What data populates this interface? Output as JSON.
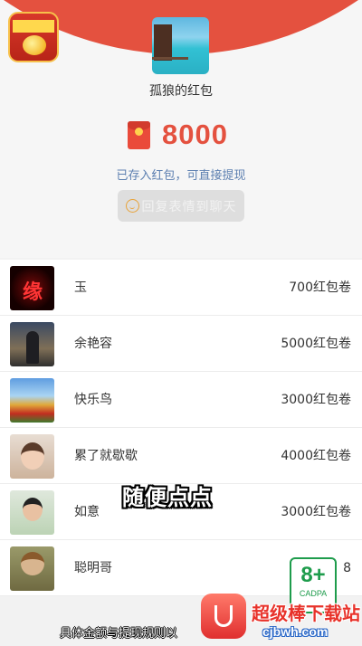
{
  "header": {
    "app_icon": "red-packet-app-icon",
    "sender_avatar": "tropical-beach-avatar",
    "sender_name": "孤狼的红包",
    "envelope_icon": "red-envelope-icon",
    "amount": "8000",
    "status_text": "已存入红包，可直接提现",
    "reply_button_label": "回复表情到聊天",
    "reply_icon": "smile-icon"
  },
  "records": [
    {
      "name": "玉",
      "value": "700红包卷",
      "avatar": "red-calligraphy-avatar"
    },
    {
      "name": "余艳容",
      "value": "5000红包卷",
      "avatar": "person-night-avatar"
    },
    {
      "name": "快乐鸟",
      "value": "3000红包卷",
      "avatar": "flower-field-avatar"
    },
    {
      "name": "累了就歇歇",
      "value": "4000红包卷",
      "avatar": "woman-portrait-avatar"
    },
    {
      "name": "如意",
      "value": "3000红包卷",
      "avatar": "child-portrait-avatar"
    },
    {
      "name": "聪明哥",
      "value": "8",
      "avatar": "cartoon-boy-avatar"
    }
  ],
  "overlay": {
    "caption": "随便点点",
    "bottom_caption": "具体金额与提现规则以",
    "age_rating": "8+",
    "age_rating_org": "CADPA",
    "watermark_title": "超级棒下载站",
    "watermark_url": "cjbwh.com"
  },
  "colors": {
    "brand_red": "#e4513f",
    "link_blue": "#5c7fb0",
    "rating_green": "#1e9c4c"
  }
}
